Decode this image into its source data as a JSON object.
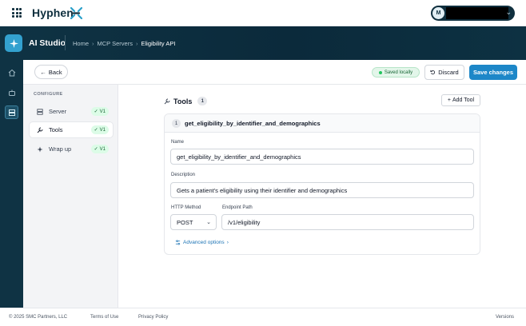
{
  "topbar": {
    "brand": "Hyphen",
    "avatar_initial": "M"
  },
  "appbar": {
    "app_name": "AI Studio",
    "breadcrumbs": [
      "Home",
      "MCP Servers",
      "Eligibility API"
    ]
  },
  "actions": {
    "back_label": "Back",
    "saved_status": "Saved locally",
    "discard_label": "Discard",
    "save_label": "Save changes"
  },
  "sidebar": {
    "heading": "CONFIGURE",
    "items": [
      {
        "label": "Server",
        "version": "V1",
        "icon": "server-icon"
      },
      {
        "label": "Tools",
        "version": "V1",
        "icon": "wrench-icon"
      },
      {
        "label": "Wrap up",
        "version": "V1",
        "icon": "sparkle-icon"
      }
    ],
    "active": "Tools"
  },
  "tools": {
    "title": "Tools",
    "count": "1",
    "add_label": "Add Tool",
    "items": [
      {
        "index": "1",
        "header_name": "get_eligibility_by_identifier_and_demographics",
        "name_label": "Name",
        "name_value": "get_eligibility_by_identifier_and_demographics",
        "description_label": "Description",
        "description_value": "Gets a patient's eligibility using their identifier and demographics",
        "method_label": "HTTP Method",
        "method_value": "POST",
        "endpoint_label": "Endpoint Path",
        "endpoint_value": "/v1/eligibility",
        "advanced_label": "Advanced options"
      }
    ]
  },
  "footer": {
    "copyright": "© 2025 SMC Partners, LLC",
    "terms": "Terms of Use",
    "privacy": "Privacy Policy",
    "versions": "Versions"
  },
  "colors": {
    "navy": "#0f3344",
    "accent": "#1d87c8",
    "success": "#22c55e"
  }
}
